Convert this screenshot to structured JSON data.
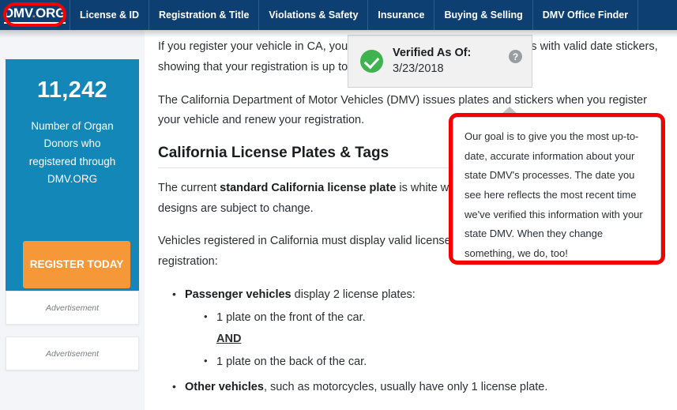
{
  "nav": {
    "logo": {
      "primary": "DMV",
      "dot": ".",
      "secondary": "ORG"
    },
    "items": [
      {
        "label": "License & ID"
      },
      {
        "label": "Registration & Title"
      },
      {
        "label": "Violations & Safety"
      },
      {
        "label": "Insurance"
      },
      {
        "label": "Buying & Selling"
      },
      {
        "label": "DMV Office Finder"
      }
    ]
  },
  "sidebar": {
    "donor_widget": {
      "count": "11,242",
      "description": "Number of Organ Donors who registered through DMV.ORG",
      "button_label": "REGISTER TODAY"
    },
    "ads": [
      {
        "label": "Advertisement"
      },
      {
        "label": "Advertisement"
      }
    ]
  },
  "verified": {
    "label": "Verified As Of:",
    "date": "3/23/2018",
    "help_icon": "?",
    "tooltip": "Our goal is to give you the most up-to-date, accurate information about your state DMV's processes. The date you see here reflects the most recent time we've verified this information with your state DMV. When they change something, we do, too!"
  },
  "content": {
    "p1": "If you register your vehicle in CA, you are required to display license plates with valid date stickers, showing that your registration is up to date.",
    "p2_pre": "The California Department of Motor Vehicles (DMV) issues plates and stickers when you register your vehicle and renew your registration.",
    "heading": "California License Plates & Tags",
    "p3_pre": "The current ",
    "p3_bold": "standard California license plate",
    "p3_post": " is white with blue lettering. Note that license plate designs are subject to change.",
    "p4": "Vehicles registered in California must display valid license plates as evidence of current registration:",
    "bullets": {
      "passenger_bold": "Passenger vehicles",
      "passenger_rest": " display 2 license plates:",
      "sub1": "1 plate on the front of the car.",
      "and": "AND",
      "sub2": "1 plate on the back of the car.",
      "other_bold": "Other vehicles",
      "other_rest": ", such as motorcycles, usually have only 1 license plate."
    }
  },
  "colors": {
    "nav_blue": "#0d3f72",
    "widget_teal": "#1287b8",
    "button_orange": "#f79838",
    "check_green": "#3fb34f",
    "annotation_red": "#f40000"
  }
}
